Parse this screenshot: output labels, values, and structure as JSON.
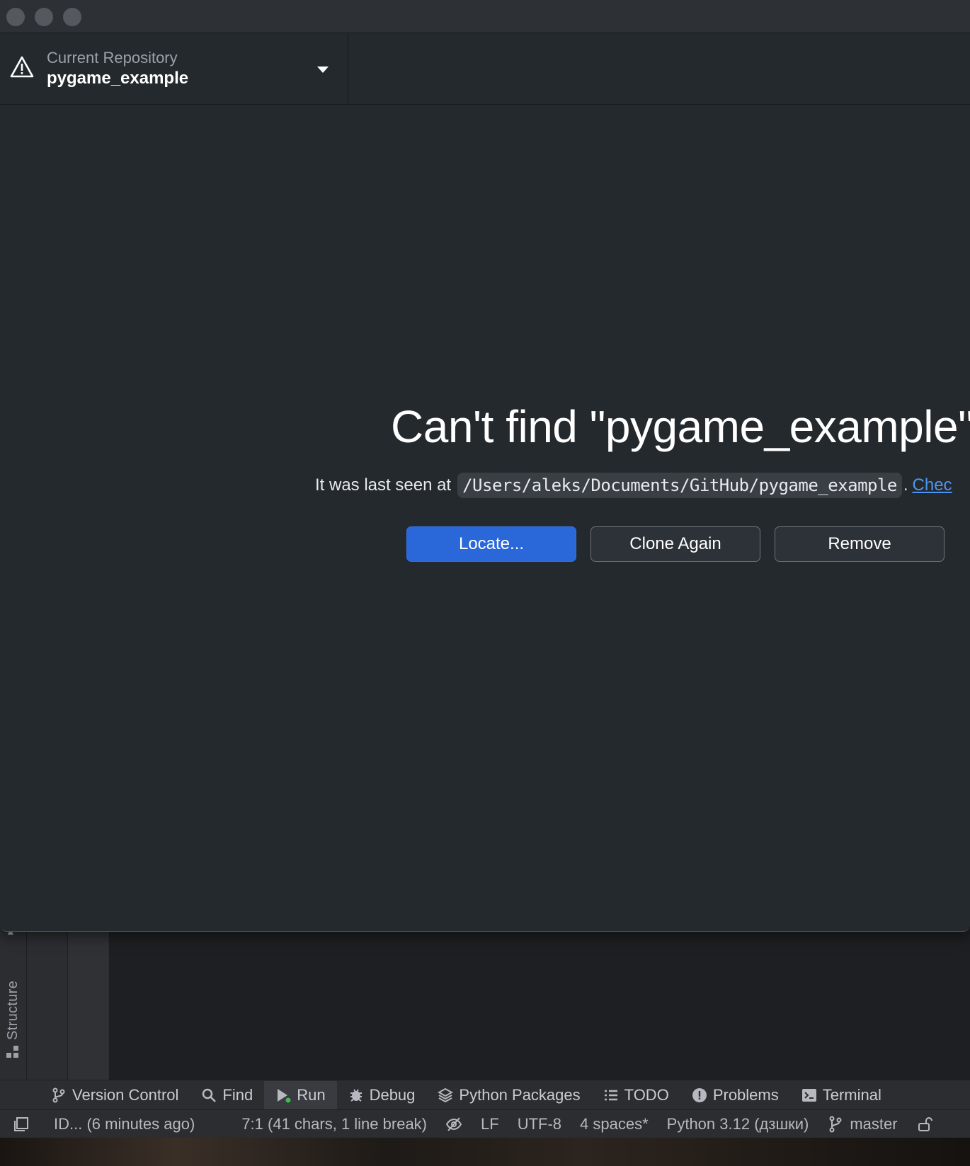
{
  "repository_bar": {
    "caption": "Current Repository",
    "name": "pygame_example"
  },
  "missing_repo": {
    "heading": "Can't find \"pygame_example\"",
    "last_seen_prefix": "It was last seen at",
    "path": "/Users/aleks/Documents/GitHub/pygame_example",
    "period": ".",
    "check_link": "Chec",
    "buttons": {
      "locate": "Locate...",
      "clone_again": "Clone Again",
      "remove": "Remove"
    }
  },
  "ide": {
    "side_tab": "Structure",
    "tool_windows": [
      {
        "label": "Version Control",
        "icon": "branch-icon"
      },
      {
        "label": "Find",
        "icon": "search-icon"
      },
      {
        "label": "Run",
        "icon": "run-icon",
        "active": true
      },
      {
        "label": "Debug",
        "icon": "bug-icon"
      },
      {
        "label": "Python Packages",
        "icon": "layers-icon"
      },
      {
        "label": "TODO",
        "icon": "list-icon"
      },
      {
        "label": "Problems",
        "icon": "alert-circle-icon"
      },
      {
        "label": "Terminal",
        "icon": "terminal-icon"
      }
    ],
    "status_bar": {
      "message": "ID... (6 minutes ago)",
      "caret_position": "7:1 (41 chars, 1 line break)",
      "line_separator": "LF",
      "encoding": "UTF-8",
      "indent": "4 spaces*",
      "interpreter": "Python 3.12 (дзшки)",
      "branch": "master"
    }
  },
  "colors": {
    "primary_button": "#2a67d8",
    "link": "#4d95f2",
    "window_bg": "#24292e"
  }
}
